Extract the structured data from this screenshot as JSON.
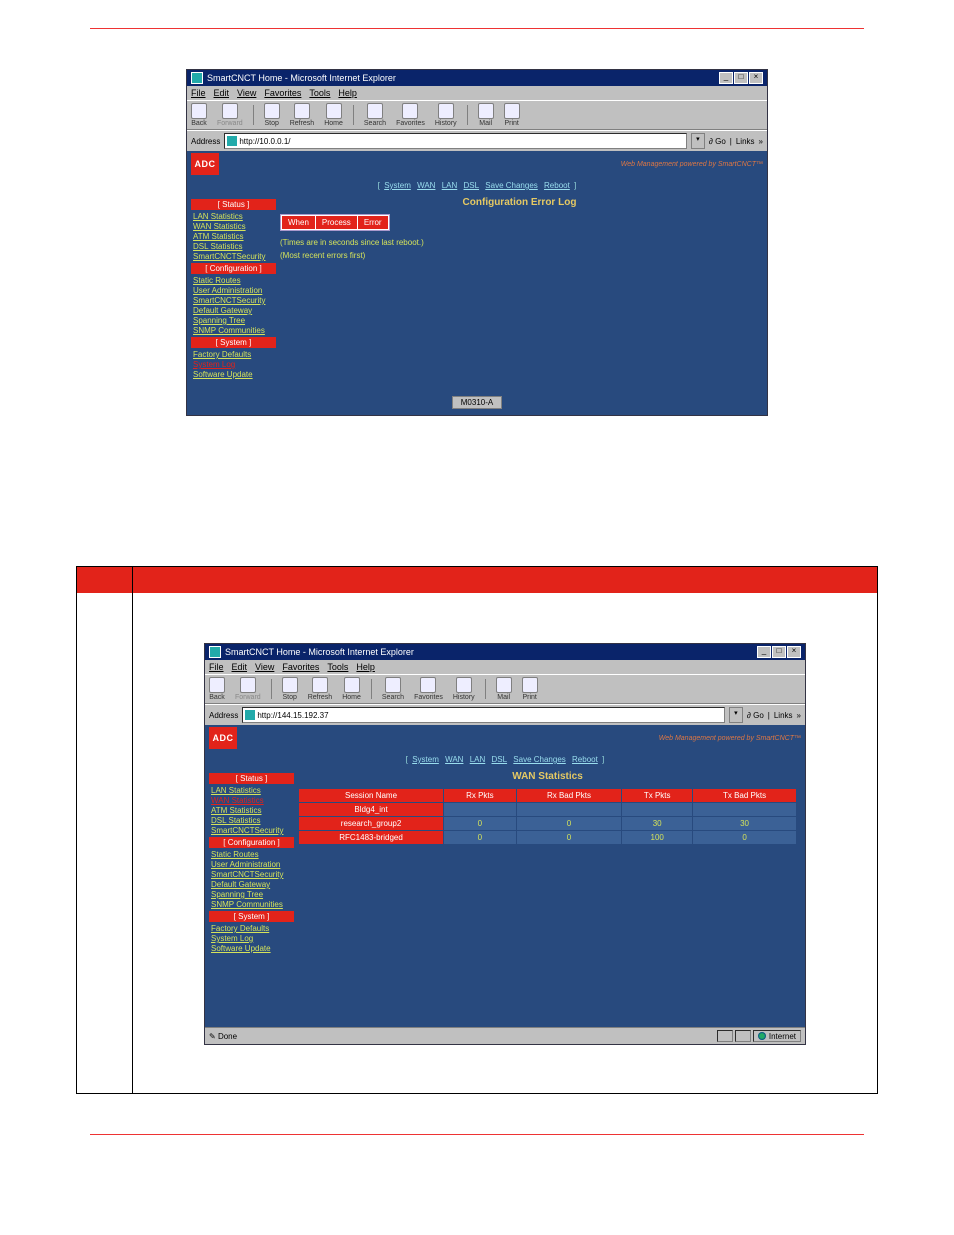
{
  "ieWindow1": {
    "title": "SmartCNCT Home - Microsoft Internet Explorer",
    "menus": [
      "File",
      "Edit",
      "View",
      "Favorites",
      "Tools",
      "Help"
    ],
    "toolbar": [
      {
        "label": "Back",
        "name": "back-button",
        "enabled": true
      },
      {
        "label": "Forward",
        "name": "forward-button",
        "enabled": false
      },
      {
        "label": "Stop",
        "name": "stop-button",
        "enabled": true
      },
      {
        "label": "Refresh",
        "name": "refresh-button",
        "enabled": true
      },
      {
        "label": "Home",
        "name": "home-button",
        "enabled": true
      },
      {
        "label": "Search",
        "name": "search-button",
        "enabled": true
      },
      {
        "label": "Favorites",
        "name": "favorites-button",
        "enabled": true
      },
      {
        "label": "History",
        "name": "history-button",
        "enabled": true
      },
      {
        "label": "Mail",
        "name": "mail-button",
        "enabled": true
      },
      {
        "label": "Print",
        "name": "print-button",
        "enabled": true
      }
    ],
    "addressLabel": "Address",
    "addressValue": "http://10.0.0.1/",
    "goLabel": "Go",
    "linksLabel": "Links",
    "logoText": "ADC",
    "wmText": "Web Management powered by SmartCNCT™",
    "subnav": {
      "left": "[",
      "right": "]",
      "links": [
        "System",
        "WAN",
        "LAN",
        "DSL",
        "Save Changes",
        "Reboot"
      ]
    },
    "sidebar": {
      "sections": [
        {
          "header": "[ Status ]",
          "links": [
            {
              "label": "LAN Statistics",
              "active": false
            },
            {
              "label": "WAN Statistics",
              "active": false
            },
            {
              "label": "ATM Statistics",
              "active": false
            },
            {
              "label": "DSL Statistics",
              "active": false
            },
            {
              "label": "SmartCNCTSecurity",
              "active": false
            }
          ]
        },
        {
          "header": "[ Configuration ]",
          "links": [
            {
              "label": "Static Routes",
              "active": false
            },
            {
              "label": "User Administration",
              "active": false
            },
            {
              "label": "SmartCNCTSecurity",
              "active": false
            },
            {
              "label": "Default Gateway",
              "active": false
            },
            {
              "label": "Spanning Tree",
              "active": false
            },
            {
              "label": "SNMP Communities",
              "active": false
            }
          ]
        },
        {
          "header": "[ System ]",
          "links": [
            {
              "label": "Factory Defaults",
              "active": false
            },
            {
              "label": "System Log",
              "active": true
            },
            {
              "label": "Software Update",
              "active": false
            }
          ]
        }
      ]
    },
    "pageTitle": "Configuration Error Log",
    "errTable": {
      "headers": [
        "When",
        "Process",
        "Error"
      ]
    },
    "note1": "(Times are in seconds since last reboot.)",
    "note2": "(Most recent errors first)",
    "modelBadge": "M0310-A"
  },
  "ieWindow2": {
    "title": "SmartCNCT Home - Microsoft Internet Explorer",
    "menus": [
      "File",
      "Edit",
      "View",
      "Favorites",
      "Tools",
      "Help"
    ],
    "toolbar": [
      {
        "label": "Back",
        "name": "back-button",
        "enabled": true
      },
      {
        "label": "Forward",
        "name": "forward-button",
        "enabled": false
      },
      {
        "label": "Stop",
        "name": "stop-button",
        "enabled": true
      },
      {
        "label": "Refresh",
        "name": "refresh-button",
        "enabled": true
      },
      {
        "label": "Home",
        "name": "home-button",
        "enabled": true
      },
      {
        "label": "Search",
        "name": "search-button",
        "enabled": true
      },
      {
        "label": "Favorites",
        "name": "favorites-button",
        "enabled": true
      },
      {
        "label": "History",
        "name": "history-button",
        "enabled": true
      },
      {
        "label": "Mail",
        "name": "mail-button",
        "enabled": true
      },
      {
        "label": "Print",
        "name": "print-button",
        "enabled": true
      }
    ],
    "addressLabel": "Address",
    "addressValue": "http://144.15.192.37",
    "goLabel": "Go",
    "linksLabel": "Links",
    "logoText": "ADC",
    "wmText": "Web Management powered by SmartCNCT™",
    "subnav": {
      "left": "[",
      "right": "]",
      "links": [
        "System",
        "WAN",
        "LAN",
        "DSL",
        "Save Changes",
        "Reboot"
      ]
    },
    "sidebar": {
      "sections": [
        {
          "header": "[ Status ]",
          "links": [
            {
              "label": "LAN Statistics",
              "active": false
            },
            {
              "label": "WAN Statistics",
              "active": true
            },
            {
              "label": "ATM Statistics",
              "active": false
            },
            {
              "label": "DSL Statistics",
              "active": false
            },
            {
              "label": "SmartCNCTSecurity",
              "active": false
            }
          ]
        },
        {
          "header": "[ Configuration ]",
          "links": [
            {
              "label": "Static Routes",
              "active": false
            },
            {
              "label": "User Administration",
              "active": false
            },
            {
              "label": "SmartCNCTSecurity",
              "active": false
            },
            {
              "label": "Default Gateway",
              "active": false
            },
            {
              "label": "Spanning Tree",
              "active": false
            },
            {
              "label": "SNMP Communities",
              "active": false
            }
          ]
        },
        {
          "header": "[ System ]",
          "links": [
            {
              "label": "Factory Defaults",
              "active": false
            },
            {
              "label": "System Log",
              "active": false
            },
            {
              "label": "Software Update",
              "active": false
            }
          ]
        }
      ]
    },
    "pageTitle": "WAN Statistics",
    "wanTable": {
      "headers": [
        "Session Name",
        "Rx Pkts",
        "Rx Bad Pkts",
        "Tx Pkts",
        "Tx Bad Pkts"
      ],
      "rows": [
        {
          "name": "Bldg4_int",
          "rx": "",
          "rxb": "",
          "tx": "",
          "txb": ""
        },
        {
          "name": "research_group2",
          "rx": "0",
          "rxb": "0",
          "tx": "30",
          "txb": "30"
        },
        {
          "name": "RFC1483-bridged",
          "rx": "0",
          "rxb": "0",
          "tx": "100",
          "txb": "0"
        }
      ]
    },
    "statusLeft": "Done",
    "statusRight": "Internet"
  }
}
